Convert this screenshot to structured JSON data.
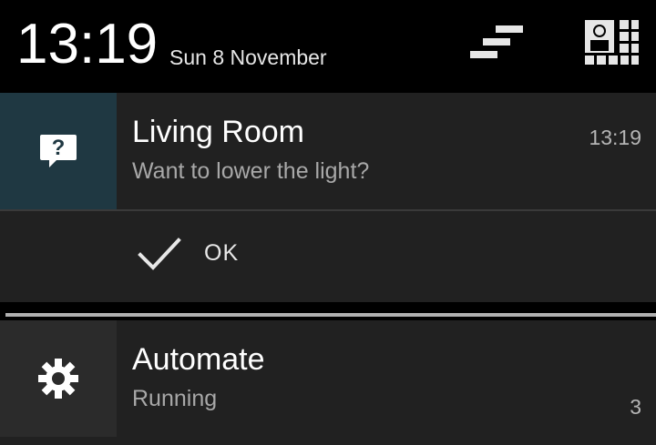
{
  "status": {
    "clock": "13:19",
    "date": "Sun 8 November"
  },
  "header_icons": {
    "settings": "quick-settings-bars-icon",
    "quick": "profile-grid-icon"
  },
  "notifications": [
    {
      "title": "Living Room",
      "text": "Want to lower the light?",
      "time": "13:19",
      "icon": "question-bubble-icon",
      "icon_bg": "#1f3842",
      "action": {
        "label": "OK",
        "icon": "checkmark-icon"
      }
    },
    {
      "title": "Automate",
      "text": "Running",
      "count": "3",
      "icon": "gear-icon",
      "icon_bg": "#2b2b2b"
    }
  ],
  "colors": {
    "background": "#000000",
    "card": "#212121",
    "accent_icon_bg": "#1f3842"
  }
}
